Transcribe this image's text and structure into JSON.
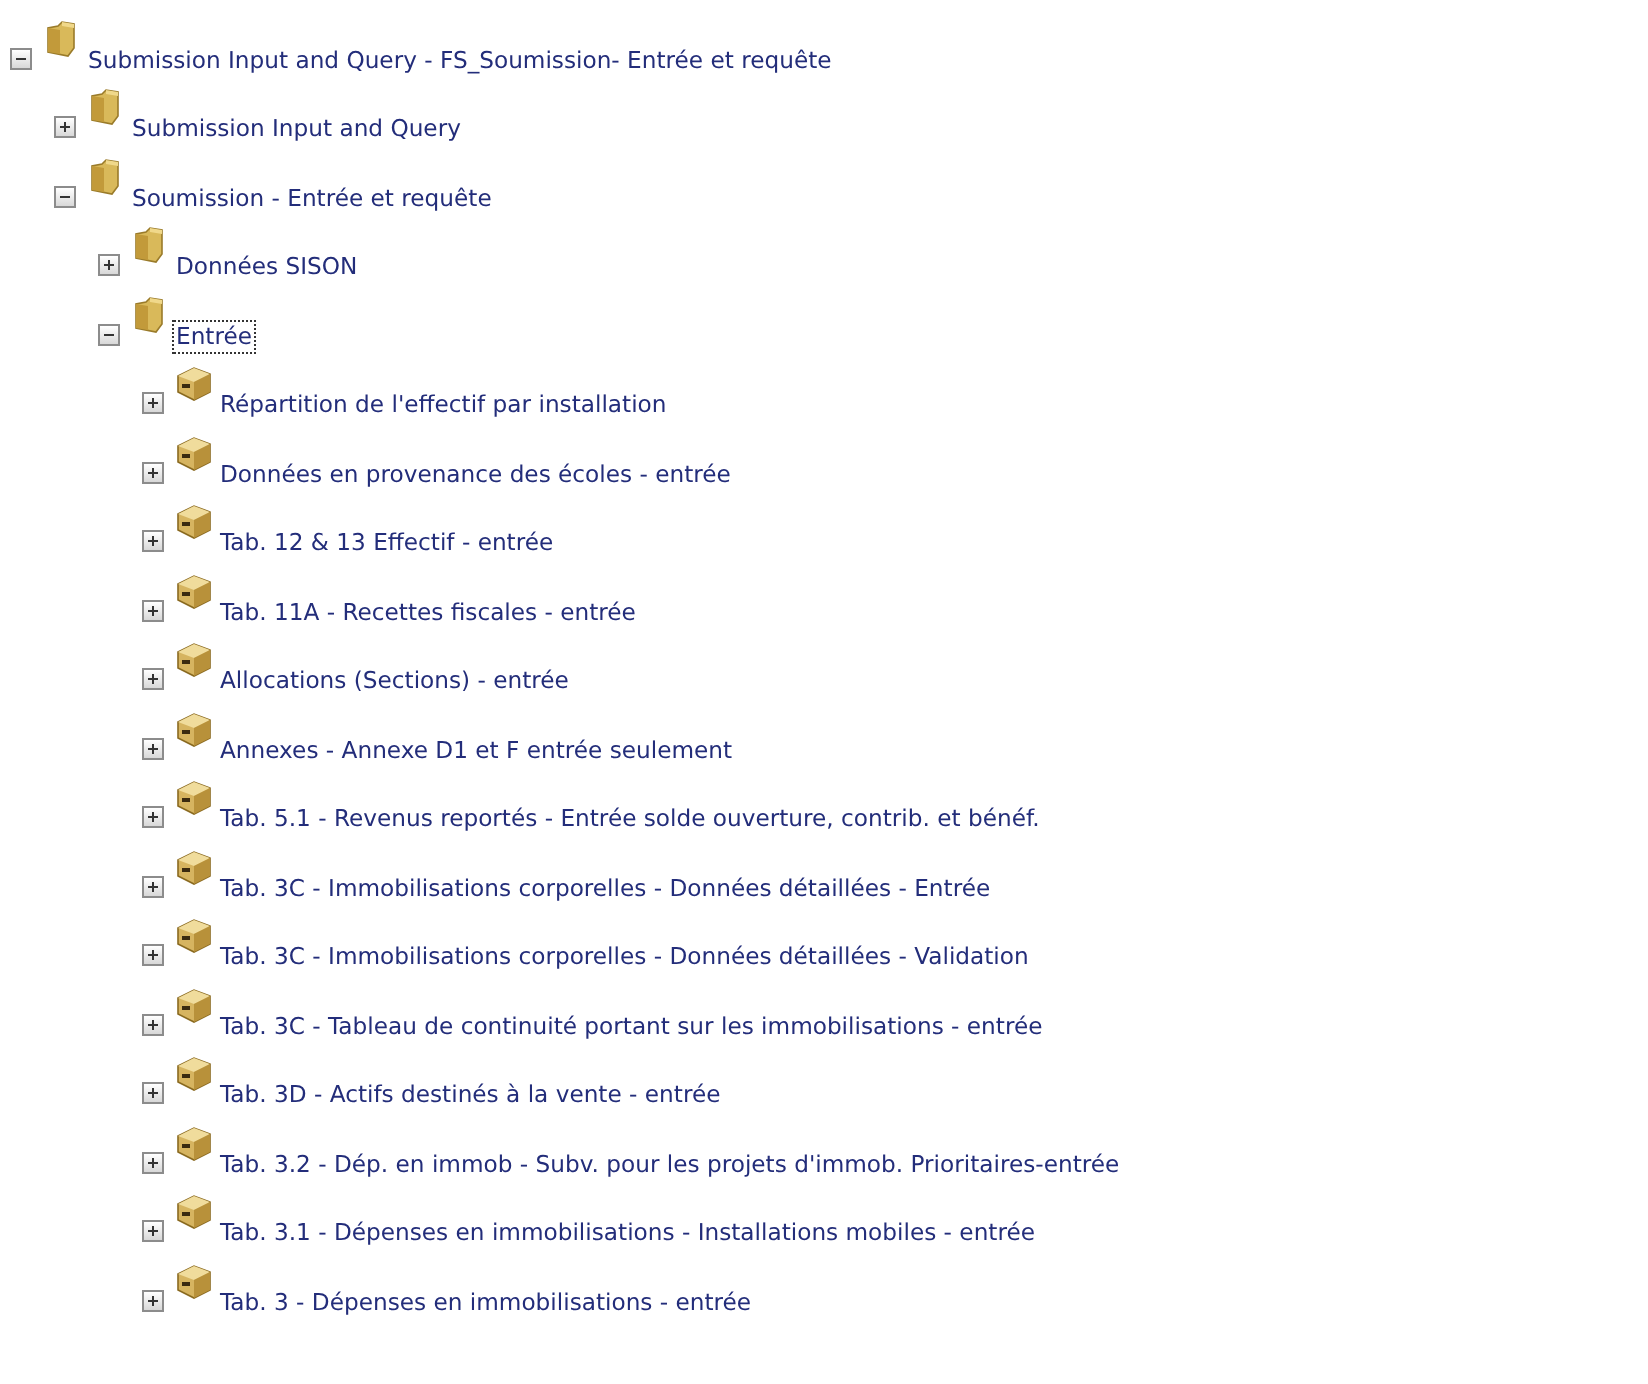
{
  "tree": [
    {
      "label": "Submission Input and Query - FS_Soumission- Entrée et requête",
      "kind": "folder",
      "expanded": true,
      "selected": false,
      "children": [
        {
          "label": "Submission Input and Query",
          "kind": "folder",
          "expanded": false,
          "selected": false
        },
        {
          "label": "Soumission - Entrée et requête",
          "kind": "folder",
          "expanded": true,
          "selected": false,
          "children": [
            {
              "label": "Données SISON",
              "kind": "folder",
              "expanded": false,
              "selected": false
            },
            {
              "label": "Entrée",
              "kind": "folder",
              "expanded": true,
              "selected": true,
              "children": [
                {
                  "label": "Répartition de l'effectif par installation",
                  "kind": "cube",
                  "expanded": false,
                  "selected": false
                },
                {
                  "label": "Données en provenance des écoles - entrée",
                  "kind": "cube",
                  "expanded": false,
                  "selected": false
                },
                {
                  "label": "Tab. 12 & 13 Effectif - entrée",
                  "kind": "cube",
                  "expanded": false,
                  "selected": false
                },
                {
                  "label": "Tab. 11A - Recettes fiscales - entrée",
                  "kind": "cube",
                  "expanded": false,
                  "selected": false
                },
                {
                  "label": "Allocations (Sections) - entrée",
                  "kind": "cube",
                  "expanded": false,
                  "selected": false
                },
                {
                  "label": "Annexes - Annexe D1 et F entrée seulement",
                  "kind": "cube",
                  "expanded": false,
                  "selected": false
                },
                {
                  "label": "Tab. 5.1 - Revenus reportés - Entrée solde ouverture, contrib. et bénéf.",
                  "kind": "cube",
                  "expanded": false,
                  "selected": false
                },
                {
                  "label": "Tab. 3C - Immobilisations corporelles - Données détaillées - Entrée",
                  "kind": "cube",
                  "expanded": false,
                  "selected": false
                },
                {
                  "label": "Tab. 3C - Immobilisations corporelles - Données détaillées - Validation",
                  "kind": "cube",
                  "expanded": false,
                  "selected": false
                },
                {
                  "label": "Tab. 3C - Tableau de continuité portant sur les immobilisations - entrée",
                  "kind": "cube",
                  "expanded": false,
                  "selected": false
                },
                {
                  "label": "Tab. 3D - Actifs destinés à la vente - entrée",
                  "kind": "cube",
                  "expanded": false,
                  "selected": false
                },
                {
                  "label": "Tab. 3.2 - Dép. en immob - Subv. pour les projets d'immob. Prioritaires-entrée",
                  "kind": "cube",
                  "expanded": false,
                  "selected": false
                },
                {
                  "label": "Tab. 3.1 - Dépenses en immobilisations - Installations mobiles - entrée",
                  "kind": "cube",
                  "expanded": false,
                  "selected": false
                },
                {
                  "label": "Tab. 3 - Dépenses en immobilisations - entrée",
                  "kind": "cube",
                  "expanded": false,
                  "selected": false
                }
              ]
            }
          ]
        }
      ]
    }
  ]
}
